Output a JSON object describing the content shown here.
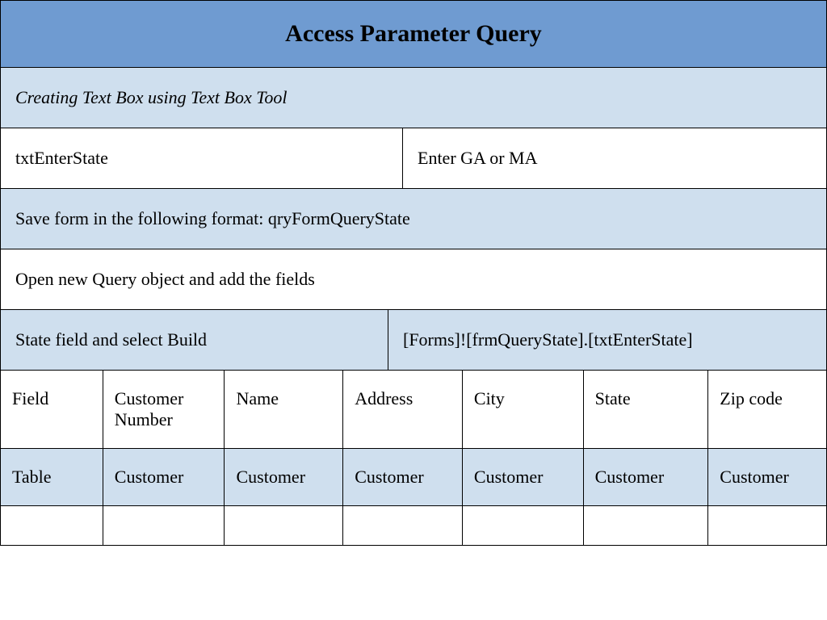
{
  "title": "Access Parameter Query",
  "subtitle": "Creating Text Box using Text Box Tool",
  "textbox_name": "txtEnterState",
  "textbox_prompt": "Enter GA or MA",
  "save_instruction": "Save form in the following format: qryFormQueryState",
  "open_instruction": "Open new Query object and add the fields",
  "build_label": "State field and select Build",
  "build_expression": "[Forms]![frmQueryState].[txtEnterState]",
  "grid": {
    "field_row": [
      "Field",
      "Customer Number",
      "Name",
      "Address",
      "City",
      "State",
      "Zip code"
    ],
    "table_row": [
      "Table",
      "Customer",
      "Customer",
      "Customer",
      "Customer",
      "Customer",
      "Customer"
    ]
  }
}
